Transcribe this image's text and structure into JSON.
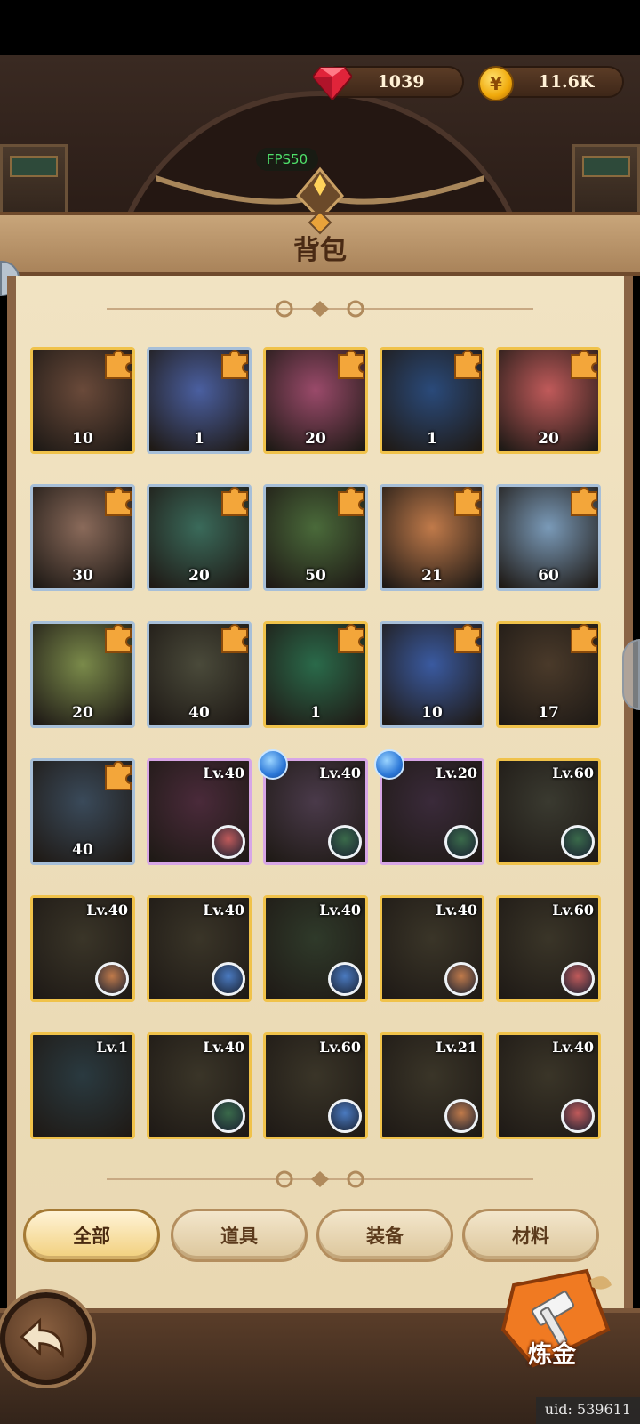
{
  "currency": {
    "gems": "1039",
    "gold": "11.6K"
  },
  "fps": "FPS50",
  "title": "背包",
  "grid": [
    {
      "kind": "hero",
      "frame": "gold",
      "count": "10",
      "art": "#6a4a3a"
    },
    {
      "kind": "hero",
      "frame": "silver",
      "count": "1",
      "art": "#4a5fa0"
    },
    {
      "kind": "hero",
      "frame": "gold",
      "count": "20",
      "art": "#9a4a6a"
    },
    {
      "kind": "hero",
      "frame": "gold",
      "count": "1",
      "art": "#2a4a7a"
    },
    {
      "kind": "hero",
      "frame": "gold",
      "count": "20",
      "art": "#c05a5a"
    },
    {
      "kind": "hero",
      "frame": "silver",
      "count": "30",
      "art": "#8a6a5a"
    },
    {
      "kind": "hero",
      "frame": "silver",
      "count": "20",
      "art": "#3a6a5a"
    },
    {
      "kind": "hero",
      "frame": "silver",
      "count": "50",
      "art": "#4a6a3a"
    },
    {
      "kind": "hero",
      "frame": "silver",
      "count": "21",
      "art": "#c07a4a"
    },
    {
      "kind": "hero",
      "frame": "silver",
      "count": "60",
      "art": "#7a9ab8"
    },
    {
      "kind": "hero",
      "frame": "silver",
      "count": "20",
      "art": "#7a8a4a"
    },
    {
      "kind": "hero",
      "frame": "silver",
      "count": "40",
      "art": "#4a4a3a"
    },
    {
      "kind": "hero",
      "frame": "gold",
      "count": "1",
      "art": "#2a6a4a"
    },
    {
      "kind": "hero",
      "frame": "silver",
      "count": "10",
      "art": "#3a5aa0"
    },
    {
      "kind": "hero",
      "frame": "gold",
      "count": "17",
      "art": "#4a3a2a"
    },
    {
      "kind": "hero",
      "frame": "silver",
      "count": "40",
      "art": "#3a4a5a"
    },
    {
      "kind": "gear",
      "frame": "purple",
      "level": "Lv.40",
      "art": "#4a2a3a",
      "owner": "#c05a5a"
    },
    {
      "kind": "gear",
      "frame": "purple",
      "level": "Lv.40",
      "art": "#4a3a4a",
      "owner": "#3a6a4a",
      "rune": true
    },
    {
      "kind": "gear",
      "frame": "purple",
      "level": "Lv.20",
      "art": "#3a2a3a",
      "owner": "#3a6a4a",
      "rune": true
    },
    {
      "kind": "gear",
      "frame": "gold",
      "level": "Lv.60",
      "art": "#3a3a30",
      "owner": "#3a6a4a"
    },
    {
      "kind": "gear",
      "frame": "gold",
      "level": "Lv.40",
      "art": "#3a3528",
      "owner": "#c07a4a"
    },
    {
      "kind": "gear",
      "frame": "gold",
      "level": "Lv.40",
      "art": "#3a3528",
      "owner": "#4a7ac0"
    },
    {
      "kind": "gear",
      "frame": "gold",
      "level": "Lv.40",
      "art": "#2f3a2a",
      "owner": "#4a7ac0"
    },
    {
      "kind": "gear",
      "frame": "gold",
      "level": "Lv.40",
      "art": "#3a3528",
      "owner": "#c07a4a"
    },
    {
      "kind": "gear",
      "frame": "gold",
      "level": "Lv.60",
      "art": "#3a3528",
      "owner": "#c05a5a"
    },
    {
      "kind": "gear",
      "frame": "gold",
      "level": "Lv.1",
      "art": "#2a3a40",
      "owner": ""
    },
    {
      "kind": "gear",
      "frame": "gold",
      "level": "Lv.40",
      "art": "#3a3528",
      "owner": "#3a6a4a"
    },
    {
      "kind": "gear",
      "frame": "gold",
      "level": "Lv.60",
      "art": "#3a3528",
      "owner": "#4a7ac0"
    },
    {
      "kind": "gear",
      "frame": "gold",
      "level": "Lv.21",
      "art": "#3a3528",
      "owner": "#c07a4a"
    },
    {
      "kind": "gear",
      "frame": "gold",
      "level": "Lv.40",
      "art": "#3a3528",
      "owner": "#c05a5a"
    }
  ],
  "tabs": [
    {
      "label": "全部",
      "active": true
    },
    {
      "label": "道具",
      "active": false
    },
    {
      "label": "装备",
      "active": false
    },
    {
      "label": "材料",
      "active": false
    }
  ],
  "alchemy_label": "炼金",
  "uid": "uid: 539611"
}
